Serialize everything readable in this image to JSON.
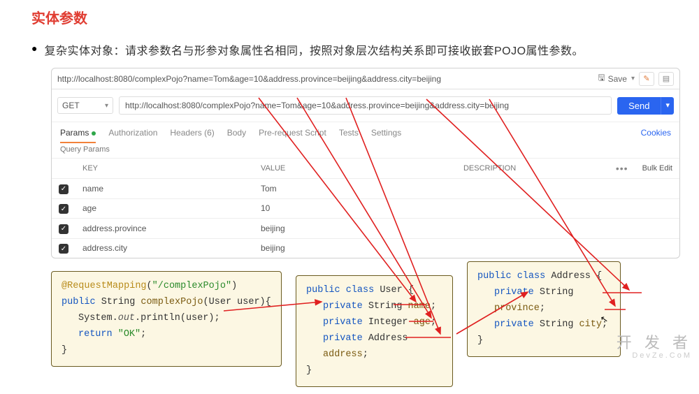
{
  "title": "实体参数",
  "bullet": "复杂实体对象：请求参数名与形参对象属性名相同，按照对象层次结构关系即可接收嵌套POJO属性参数。",
  "postman": {
    "top_url": "http://localhost:8080/complexPojo?name=Tom&age=10&address.province=beijing&address.city=beijing",
    "save_label": "Save",
    "method": "GET",
    "url_input": "http://localhost:8080/complexPojo?name=Tom&age=10&address.province=beijing&address.city=beijing",
    "send_label": "Send",
    "tabs": {
      "params": "Params",
      "auth": "Authorization",
      "headers": "Headers (6)",
      "body": "Body",
      "prereq": "Pre-request Script",
      "tests": "Tests",
      "settings": "Settings",
      "cookies": "Cookies"
    },
    "query_params_label": "Query Params",
    "columns": {
      "key": "KEY",
      "value": "VALUE",
      "description": "DESCRIPTION",
      "bulk": "Bulk Edit"
    },
    "rows": [
      {
        "key": "name",
        "value": "Tom"
      },
      {
        "key": "age",
        "value": "10"
      },
      {
        "key": "address.province",
        "value": "beijing"
      },
      {
        "key": "address.city",
        "value": "beijing"
      }
    ]
  },
  "code1": {
    "l1a": "@RequestMapping",
    "l1b": "(",
    "l1c": "\"/complexPojo\"",
    "l1d": ")",
    "l2a": "public",
    "l2b": " String ",
    "l2c": "complexPojo",
    "l2d": "(User user){",
    "l3a": "System.",
    "l3b": "out",
    "l3c": ".println(user);",
    "l4a": "return ",
    "l4b": "\"OK\"",
    "l4c": ";",
    "l5": "}"
  },
  "code2": {
    "l1a": "public class",
    "l1b": " User {",
    "l2a": "private",
    "l2b": " String ",
    "l2c": "name",
    "l2d": ";",
    "l3a": "private",
    "l3b": " Integer ",
    "l3c": "age",
    "l3d": ";",
    "l4a": "private",
    "l4b": " Address ",
    "l4c": "address",
    "l4d": ";",
    "l5": "}"
  },
  "code3": {
    "l1a": "public class",
    "l1b": " Address {",
    "l2a": "private",
    "l2b": " String ",
    "l2c": "province",
    "l2d": ";",
    "l3a": "private",
    "l3b": " String ",
    "l3c": "city",
    "l3d": ";",
    "l4": "}"
  },
  "watermark": {
    "main": "开 发 者",
    "sub": "DevZe.CoM"
  }
}
